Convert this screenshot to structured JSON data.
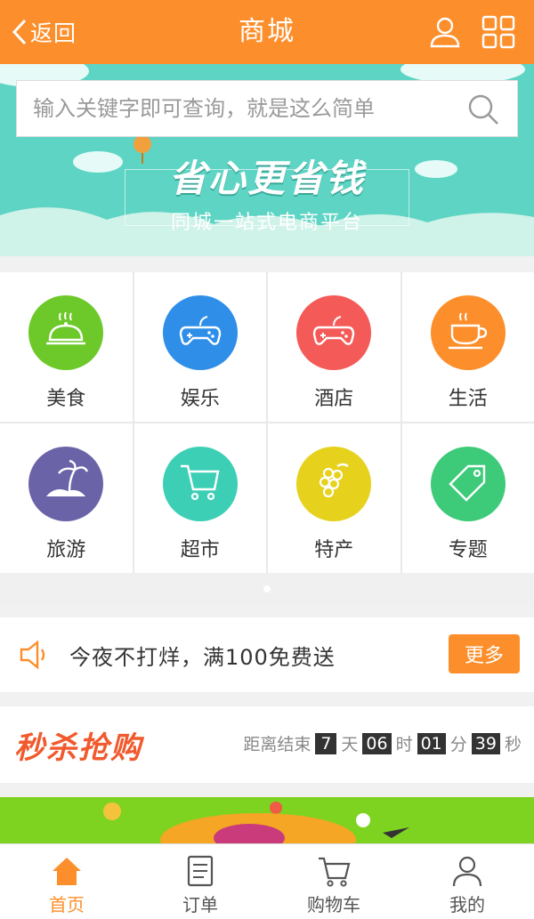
{
  "header": {
    "back_label": "返回",
    "title": "商城",
    "user_icon": "user-icon",
    "grid_icon": "grid-icon"
  },
  "banner": {
    "search_placeholder": "输入关键字即可查询，就是这么简单",
    "slogan": "省心更省钱",
    "subtitle": "同城一站式电商平台"
  },
  "categories": [
    {
      "label": "美食",
      "icon": "dish-icon",
      "color": "#6dc829"
    },
    {
      "label": "娱乐",
      "icon": "gamepad-icon",
      "color": "#2e8ee8"
    },
    {
      "label": "酒店",
      "icon": "gamepad-icon",
      "color": "#f45a57"
    },
    {
      "label": "生活",
      "icon": "coffee-cup-icon",
      "color": "#fc8f2c"
    },
    {
      "label": "旅游",
      "icon": "palm-island-icon",
      "color": "#6b63a8"
    },
    {
      "label": "超市",
      "icon": "cart-icon",
      "color": "#3dcfb6"
    },
    {
      "label": "特产",
      "icon": "grapes-icon",
      "color": "#e6d21c"
    },
    {
      "label": "专题",
      "icon": "tag-icon",
      "color": "#3dcb7a"
    }
  ],
  "notice": {
    "text": "今夜不打烊，满100免费送",
    "more_label": "更多"
  },
  "flash_sale": {
    "title": "秒杀抢购",
    "prefix": "距离结束",
    "days": "7",
    "days_unit": "天",
    "hours": "06",
    "hours_unit": "时",
    "minutes": "01",
    "minutes_unit": "分",
    "seconds": "39",
    "seconds_unit": "秒"
  },
  "tabbar": {
    "items": [
      {
        "label": "首页",
        "icon": "home-icon",
        "active": true
      },
      {
        "label": "订单",
        "icon": "order-icon",
        "active": false
      },
      {
        "label": "购物车",
        "icon": "cart-icon",
        "active": false
      },
      {
        "label": "我的",
        "icon": "user-icon",
        "active": false
      }
    ]
  },
  "colors": {
    "accent": "#fc8f2c",
    "banner": "#5ed4c4",
    "promo": "#7ed321"
  }
}
